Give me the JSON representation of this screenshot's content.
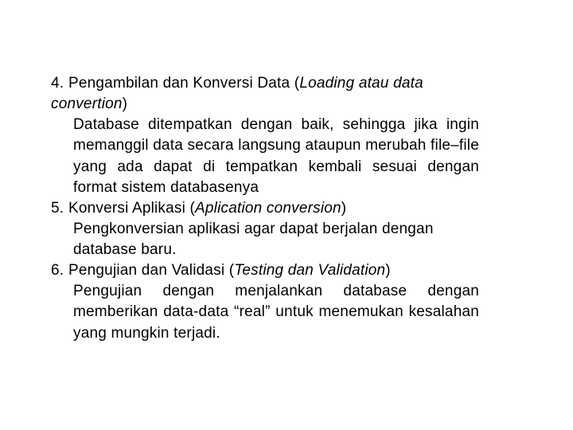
{
  "items": [
    {
      "number": "4.",
      "title_plain_before": "Pengambilan dan Konversi Data (",
      "title_italic": "Loading atau data convertion",
      "title_plain_after": ")",
      "body": "Database ditempatkan dengan baik, sehingga jika ingin memanggil data secara langsung ataupun merubah file–file yang ada dapat di tempatkan kembali sesuai dengan format sistem databasenya",
      "body_justify": true
    },
    {
      "number": "5.",
      "title_plain_before": "Konversi Aplikasi (",
      "title_italic": "Aplication conversion",
      "title_plain_after": ")",
      "body": "Pengkonversian aplikasi agar dapat berjalan dengan database baru.",
      "body_justify": false
    },
    {
      "number": "6.",
      "title_plain_before": "Pengujian dan Validasi (",
      "title_italic": "Testing dan Validation",
      "title_plain_after": ")",
      "body": "Pengujian dengan menjalankan database dengan memberikan data-data “real” untuk menemukan kesalahan yang mungkin terjadi.",
      "body_justify": true
    }
  ]
}
